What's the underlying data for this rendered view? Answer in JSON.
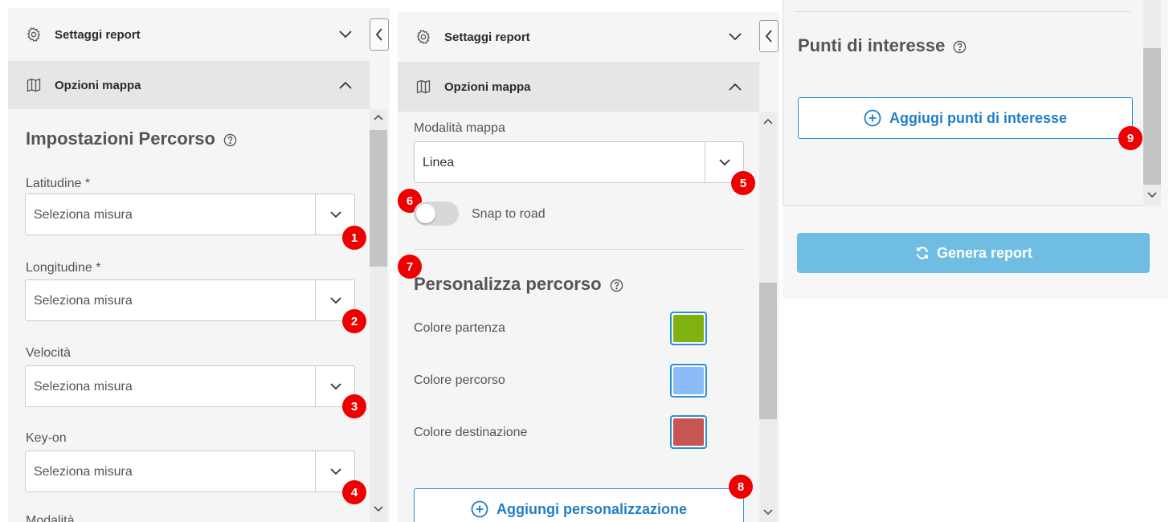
{
  "panel_left": {
    "settings_header": "Settaggi report",
    "map_header": "Opzioni mappa",
    "section_title": "Impostazioni Percorso",
    "fields": [
      {
        "label": "Latitudine *",
        "value": "Seleziona misura",
        "badge": "1"
      },
      {
        "label": "Longitudine *",
        "value": "Seleziona misura",
        "badge": "2"
      },
      {
        "label": "Velocità",
        "value": "Seleziona misura",
        "badge": "3"
      },
      {
        "label": "Key-on",
        "value": "Seleziona misura",
        "badge": "4"
      }
    ],
    "cut_label": "Modalità"
  },
  "panel_middle": {
    "settings_header": "Settaggi report",
    "map_header": "Opzioni mappa",
    "map_mode_label": "Modalità mappa",
    "map_mode_value": "Linea",
    "badge_mode": "5",
    "badge_snap": "6",
    "snap_label": "Snap to road",
    "snap_on": false,
    "badge_custom": "7",
    "custom_title": "Personalizza percorso",
    "colors": [
      {
        "label": "Colore partenza",
        "color": "#7fb10f"
      },
      {
        "label": "Colore percorso",
        "color": "#8bbcf7"
      },
      {
        "label": "Colore destinazione",
        "color": "#c75552"
      }
    ],
    "add_custom_button": "Aggiungi personalizzazione",
    "badge_add_custom": "8"
  },
  "panel_right": {
    "poi_title": "Punti di interesse",
    "add_poi_button": "Aggiugi punti di interesse",
    "badge_poi": "9",
    "generate_button": "Genera report"
  },
  "colors": {
    "accent": "#2a8fd6",
    "badge": "#ee0000",
    "generate_button": "#6fbde2"
  },
  "icons": [
    "gear-icon",
    "map-icon",
    "chevron-down-icon",
    "chevron-up-icon",
    "chevron-left-icon",
    "help-icon",
    "plus-circle-icon",
    "refresh-icon"
  ]
}
